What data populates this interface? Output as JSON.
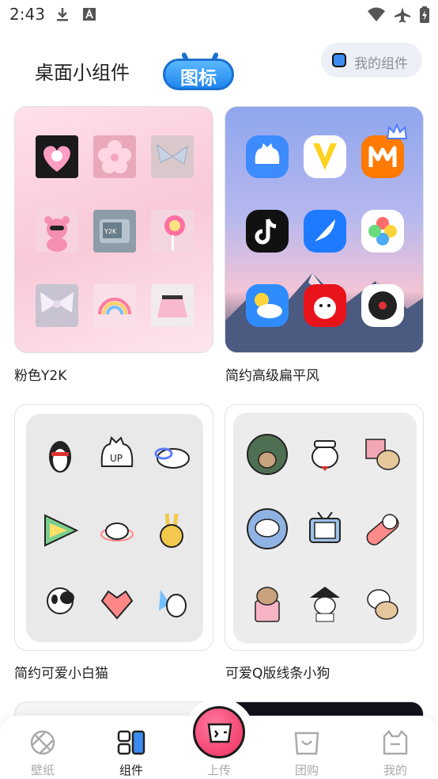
{
  "status_bar": {
    "time": "2:43",
    "icons": [
      "download-icon",
      "a-badge-icon",
      "wifi-icon",
      "airplane-icon",
      "battery-charging-icon"
    ]
  },
  "header": {
    "title": "桌面小组件",
    "badge": "图标",
    "my_widget_label": "我的组件",
    "accent": "#1f86ee"
  },
  "cards": [
    {
      "label": "粉色Y2K",
      "theme": "pink-y2k",
      "icons": [
        "bunny-heart-icon",
        "flower-icon",
        "butterfly-icon",
        "teddy-bear-icon",
        "tv-y2k-icon",
        "lollipop-icon",
        "bow-icon",
        "rainbow-icon",
        "skirt-icon"
      ]
    },
    {
      "label": "简约高级扁平风",
      "theme": "flat-mountain",
      "icons": [
        "cat-cloud-icon",
        "yellow-v-icon",
        "mango-tv-icon",
        "tiktok-icon",
        "feather-icon",
        "photos-flower-icon",
        "weather-icon",
        "joy-dog-icon",
        "music-disc-icon"
      ]
    },
    {
      "label": "简约可爱小白猫",
      "theme": "white-cat",
      "icons": [
        "penguin-icon",
        "up-cat-icon",
        "cloud-cat-icon",
        "play-triangle-icon",
        "sleeping-cat-icon",
        "bunny-icon",
        "panda-cat-icon",
        "heart-origami-icon",
        "fairy-cat-icon"
      ]
    },
    {
      "label": "可爱Q版线条小狗",
      "theme": "line-dog",
      "icons": [
        "dog-bamboo-icon",
        "sailor-dog-icon",
        "puzzle-dog-icon",
        "flying-dog-icon",
        "tv-dog-icon",
        "capsule-dog-icon",
        "dog-bag-icon",
        "hat-dog-icon",
        "dog-pair-icon"
      ]
    }
  ],
  "bottom_nav": [
    {
      "label": "壁纸",
      "icon": "wallpaper-icon",
      "active": false
    },
    {
      "label": "组件",
      "icon": "widget-icon",
      "active": true
    },
    {
      "label": "上传",
      "icon": "upload-icon",
      "active": false
    },
    {
      "label": "团购",
      "icon": "group-buy-icon",
      "active": false
    },
    {
      "label": "我的",
      "icon": "profile-icon",
      "active": false
    }
  ]
}
